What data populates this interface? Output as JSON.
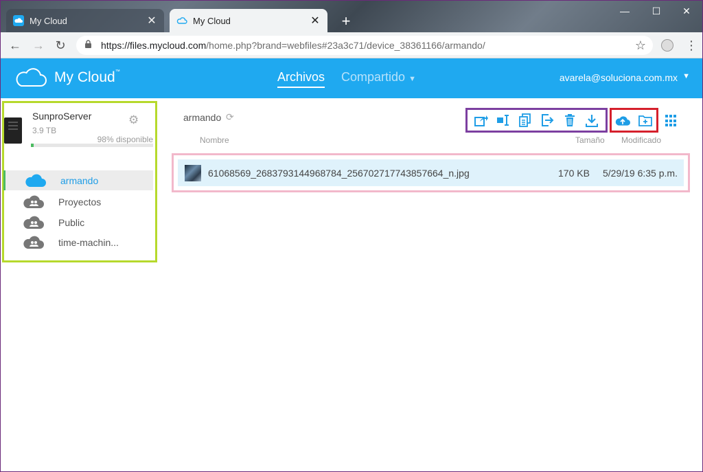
{
  "browser": {
    "tabs": [
      {
        "title": "My Cloud",
        "active": false
      },
      {
        "title": "My Cloud",
        "active": true
      }
    ],
    "url": {
      "host": "https://files.mycloud.com",
      "path": "/home.php?brand=webfiles#23a3c71/device_38361166/armando/"
    },
    "window_controls": {
      "minimize": "—",
      "maximize": "☐",
      "close": "✕"
    }
  },
  "header": {
    "logo": "My Cloud",
    "logo_tm": "™",
    "nav": {
      "archivos": "Archivos",
      "compartido": "Compartido"
    },
    "user": "avarela@soluciona.com.mx"
  },
  "sidebar": {
    "device": {
      "name": "SunproServer",
      "size": "3.9 TB",
      "available": "98% disponible",
      "used_fraction": 0.02
    },
    "shares": [
      {
        "label": "armando",
        "active": true,
        "shared": false
      },
      {
        "label": "Proyectos",
        "active": false,
        "shared": true
      },
      {
        "label": "Public",
        "active": false,
        "shared": true
      },
      {
        "label": "time-machin...",
        "active": false,
        "shared": true
      }
    ]
  },
  "main": {
    "breadcrumb": "armando",
    "columns": {
      "name": "Nombre",
      "size": "Tamaño",
      "modified": "Modificado"
    },
    "files": [
      {
        "name": "61068569_2683793144968784_256702717743857664_n.jpg",
        "size": "170 KB",
        "modified": "5/29/19 6:35 p.m."
      }
    ]
  },
  "colors": {
    "accent": "#1fa9f0",
    "sidebar_highlight": "#b6d92c",
    "actions_highlight": "#7c3fa0",
    "upload_highlight": "#d5202c",
    "file_highlight": "#f2b8cb"
  }
}
